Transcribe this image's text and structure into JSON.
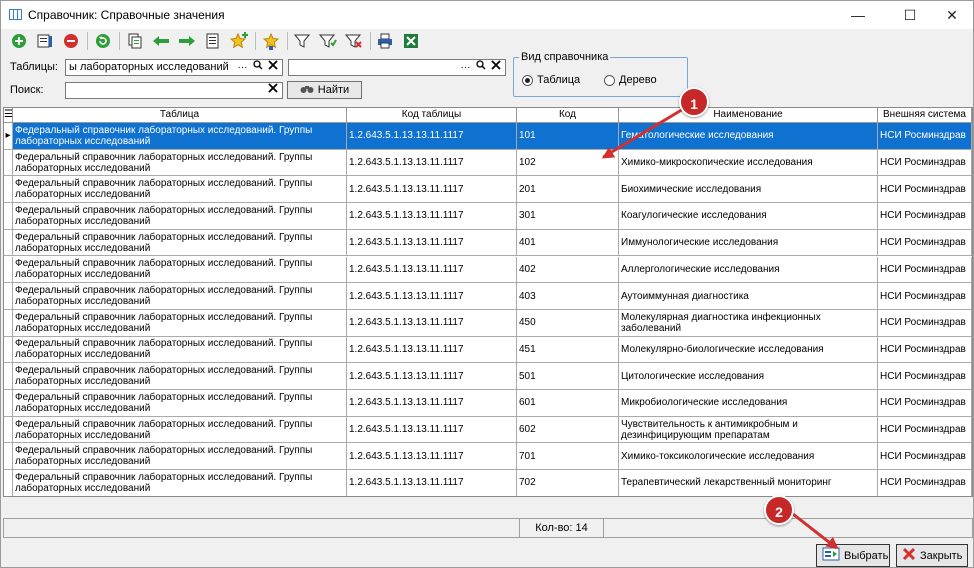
{
  "window": {
    "title": "Справочник: Справочные значения",
    "minimize": "—",
    "maximize": "☐",
    "close": "✕"
  },
  "toolbar": {
    "icons": [
      "add-icon",
      "edit-icon",
      "delete-icon",
      "refresh-icon",
      "copy-icon",
      "arrow-left-icon",
      "arrow-right-icon",
      "import-icon",
      "star-add-icon",
      "favorite-icon",
      "filter-icon",
      "filter-edit-icon",
      "filter-clear-icon",
      "print-icon",
      "excel-export-icon"
    ]
  },
  "filters": {
    "tables_label": "Таблицы:",
    "tables_value": "ы лабораторных исследований",
    "search_label": "Поиск:",
    "search_value": "",
    "second_value": "",
    "ellipsis": "···",
    "find_button": "Найти"
  },
  "view_type": {
    "label": "Вид справочника",
    "option_table": "Таблица",
    "option_tree": "Дерево",
    "selected": "Таблица"
  },
  "grid": {
    "columns": [
      "Таблица",
      "Код таблицы",
      "Код",
      "Наименование",
      "Внешняя система"
    ],
    "rows": [
      [
        "Федеральный справочник лабораторных исследований. Группы лабораторных исследований",
        "1.2.643.5.1.13.13.11.1117",
        "101",
        "Гематологические исследования",
        "НСИ Росминздрав"
      ],
      [
        "Федеральный справочник лабораторных исследований. Группы лабораторных исследований",
        "1.2.643.5.1.13.13.11.1117",
        "102",
        "Химико-микроскопические исследования",
        "НСИ Росминздрав"
      ],
      [
        "Федеральный справочник лабораторных исследований. Группы лабораторных исследований",
        "1.2.643.5.1.13.13.11.1117",
        "201",
        "Биохимические исследования",
        "НСИ Росминздрав"
      ],
      [
        "Федеральный справочник лабораторных исследований. Группы лабораторных исследований",
        "1.2.643.5.1.13.13.11.1117",
        "301",
        "Коагулогические исследования",
        "НСИ Росминздрав"
      ],
      [
        "Федеральный справочник лабораторных исследований. Группы лабораторных исследований",
        "1.2.643.5.1.13.13.11.1117",
        "401",
        "Иммунологические исследования",
        "НСИ Росминздрав"
      ],
      [
        "Федеральный справочник лабораторных исследований. Группы лабораторных исследований",
        "1.2.643.5.1.13.13.11.1117",
        "402",
        "Аллергологические исследования",
        "НСИ Росминздрав"
      ],
      [
        "Федеральный справочник лабораторных исследований. Группы лабораторных исследований",
        "1.2.643.5.1.13.13.11.1117",
        "403",
        "Аутоиммунная диагностика",
        "НСИ Росминздрав"
      ],
      [
        "Федеральный справочник лабораторных исследований. Группы лабораторных исследований",
        "1.2.643.5.1.13.13.11.1117",
        "450",
        "Молекулярная диагностика инфекционных заболеваний",
        "НСИ Росминздрав"
      ],
      [
        "Федеральный справочник лабораторных исследований. Группы лабораторных исследований",
        "1.2.643.5.1.13.13.11.1117",
        "451",
        "Молекулярно-биологические исследования",
        "НСИ Росминздрав"
      ],
      [
        "Федеральный справочник лабораторных исследований. Группы лабораторных исследований",
        "1.2.643.5.1.13.13.11.1117",
        "501",
        "Цитологические исследования",
        "НСИ Росминздрав"
      ],
      [
        "Федеральный справочник лабораторных исследований. Группы лабораторных исследований",
        "1.2.643.5.1.13.13.11.1117",
        "601",
        "Микробиологические исследования",
        "НСИ Росминздрав"
      ],
      [
        "Федеральный справочник лабораторных исследований. Группы лабораторных исследований",
        "1.2.643.5.1.13.13.11.1117",
        "602",
        "Чувствительность к антимикробным и дезинфицирующим препаратам",
        "НСИ Росминздрав"
      ],
      [
        "Федеральный справочник лабораторных исследований. Группы лабораторных исследований",
        "1.2.643.5.1.13.13.11.1117",
        "701",
        "Химико-токсикологические исследования",
        "НСИ Росминздрав"
      ],
      [
        "Федеральный справочник лабораторных исследований. Группы лабораторных исследований",
        "1.2.643.5.1.13.13.11.1117",
        "702",
        "Терапевтический лекарственный мониторинг",
        "НСИ Росминздрав"
      ]
    ],
    "selected_index": 0,
    "current_row_marker": "▸",
    "menu_glyph": "☰"
  },
  "status": {
    "count_text": "Кол-во: 14"
  },
  "buttons": {
    "select": "Выбрать",
    "close": "Закрыть"
  },
  "annotations": {
    "badge1": "1",
    "badge2": "2"
  },
  "colors": {
    "selection": "#0f71d0",
    "annotation": "#c62828"
  }
}
